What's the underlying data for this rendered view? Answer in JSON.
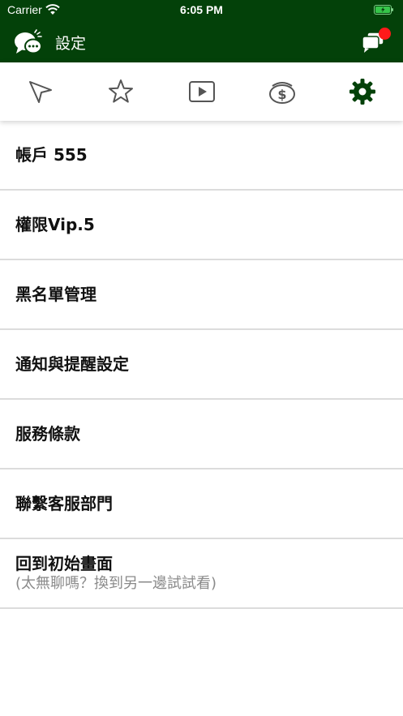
{
  "status_bar": {
    "carrier": "Carrier",
    "time": "6:05 PM"
  },
  "header": {
    "title": "設定"
  },
  "tabs": [
    {
      "icon": "navigation-arrow-icon"
    },
    {
      "icon": "star-icon"
    },
    {
      "icon": "play-video-icon"
    },
    {
      "icon": "money-wallet-icon"
    },
    {
      "icon": "gear-icon",
      "active": true
    }
  ],
  "colors": {
    "brand": "#034109",
    "notification": "#ff1a1a",
    "divider": "#dcdcdc",
    "subtext": "#8a8a8a"
  },
  "menu": [
    {
      "label": "帳戶 555"
    },
    {
      "label": "權限Vip.5"
    },
    {
      "label": "黑名單管理"
    },
    {
      "label": "通知與提醒設定"
    },
    {
      "label": "服務條款"
    },
    {
      "label": "聯繫客服部門"
    },
    {
      "label": "回到初始畫面",
      "sub": "(太無聊嗎？換到另一邊試試看)"
    }
  ]
}
